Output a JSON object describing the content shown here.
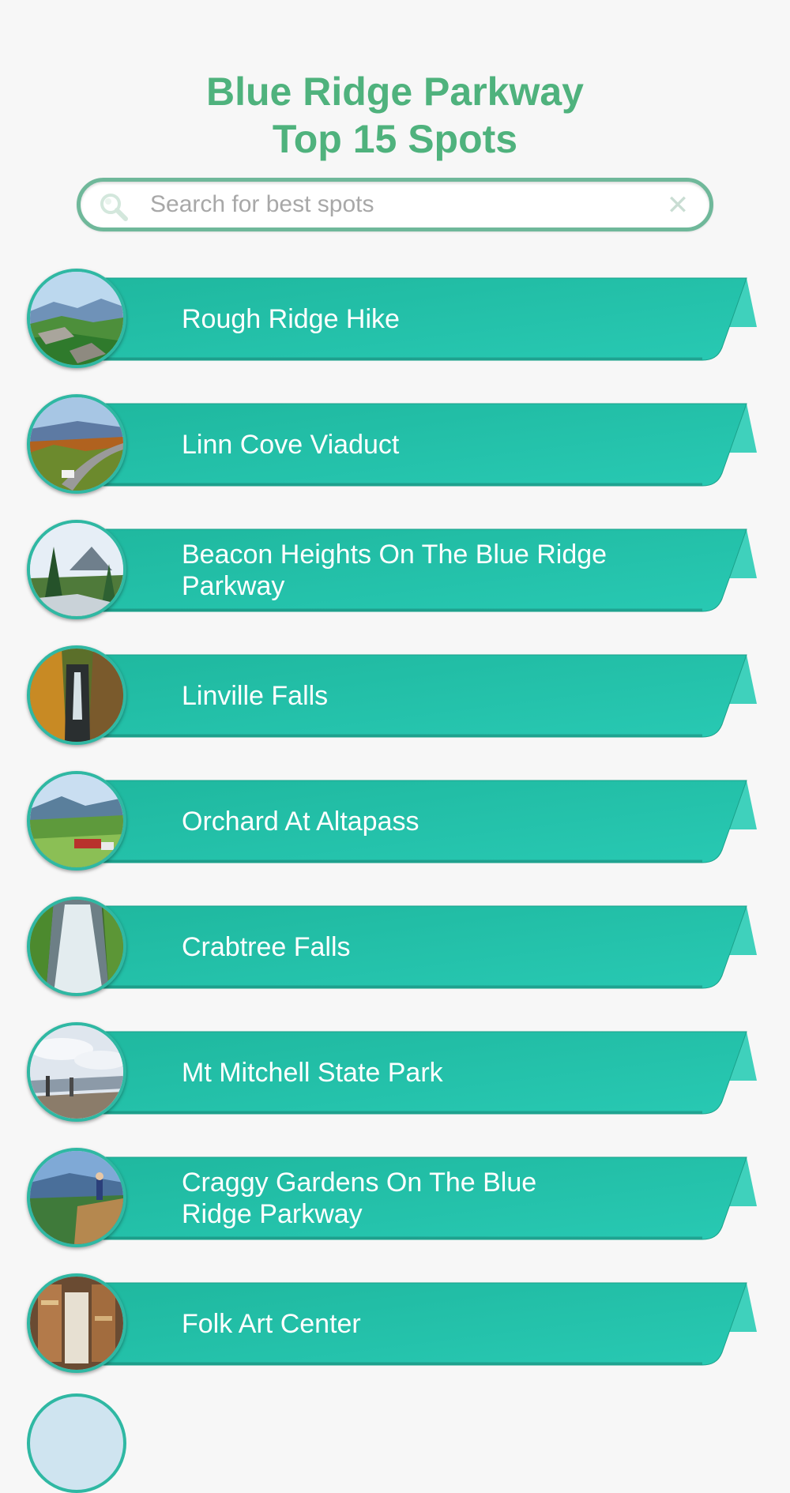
{
  "header": {
    "title_line1": "Blue Ridge Parkway",
    "title_line2": "Top 15 Spots"
  },
  "search": {
    "placeholder": "Search for best spots",
    "value": ""
  },
  "colors": {
    "title": "#4fb27d",
    "ribbon": "#22bfa6",
    "ribbon_fold": "#3fcfb9",
    "search_border": "#6fb89a",
    "background": "#f7f7f7"
  },
  "spots": [
    {
      "name": "Rough Ridge Hike",
      "image": "mountain-overlook"
    },
    {
      "name": "Linn Cove Viaduct",
      "image": "viaduct-road"
    },
    {
      "name": "Beacon Heights On The Blue Ridge Parkway",
      "image": "pine-forest-peak"
    },
    {
      "name": "Linville Falls",
      "image": "gorge-waterfall"
    },
    {
      "name": "Orchard At Altapass",
      "image": "orchard-valley"
    },
    {
      "name": "Crabtree Falls",
      "image": "waterfall"
    },
    {
      "name": "Mt Mitchell State Park",
      "image": "summit-viewpoint"
    },
    {
      "name": "Craggy Gardens On The Blue Ridge Parkway",
      "image": "hiker-overlook"
    },
    {
      "name": "Folk Art Center",
      "image": "craft-shop-interior"
    }
  ]
}
